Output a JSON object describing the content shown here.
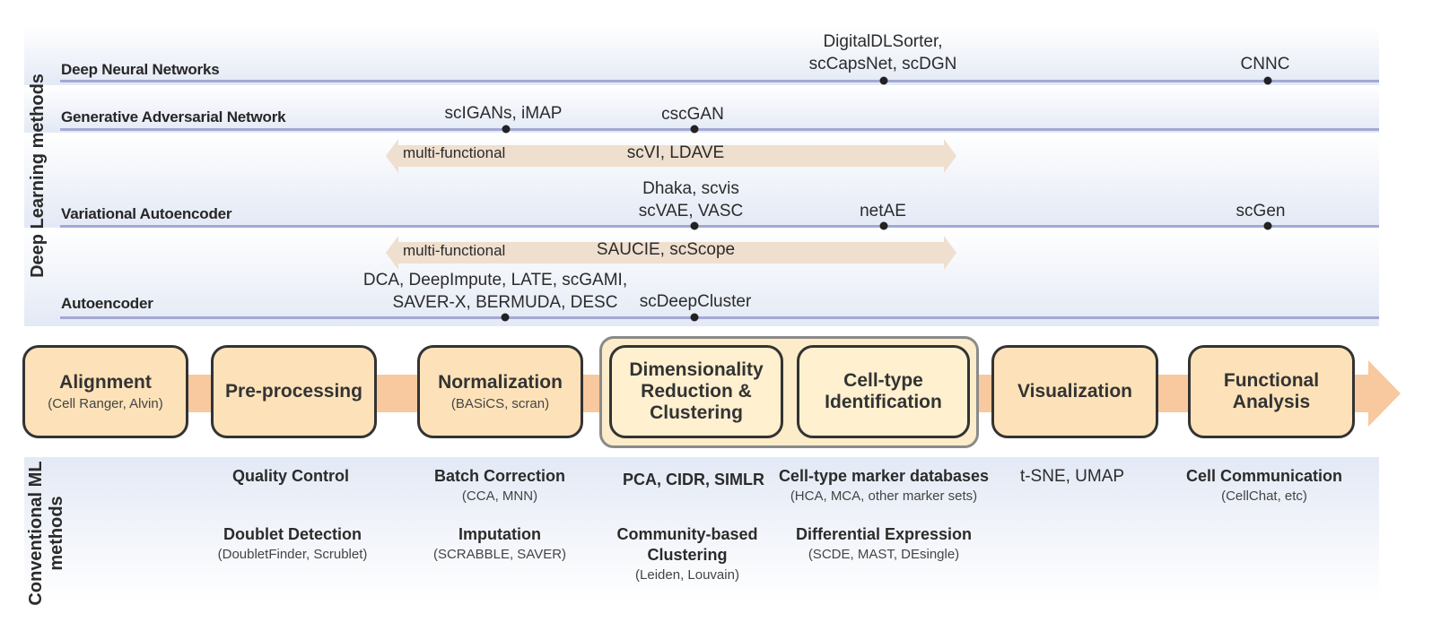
{
  "deep_learning": {
    "side_label": "Deep Learning methods",
    "categories": [
      {
        "name": "Deep Neural Networks"
      },
      {
        "name": "Generative Adversarial Network"
      },
      {
        "name": "Variational Autoencoder"
      },
      {
        "name": "Autoencoder"
      }
    ],
    "methods": {
      "dnn_1_line1": "DigitalDLSorter,",
      "dnn_1_line2": "scCapsNet, scDGN",
      "dnn_2": "CNNC",
      "gan_1": "scIGANs, iMAP",
      "gan_2": "cscGAN",
      "vae_1_line1": "Dhaka, scvis",
      "vae_1_line2": "scVAE, VASC",
      "vae_2": "netAE",
      "vae_3": "scGen",
      "ae_1_line1": "DCA, DeepImpute, LATE, scGAMI,",
      "ae_1_line2": "SAVER-X, BERMUDA, DESC",
      "ae_2": "scDeepCluster"
    },
    "multi_functional": [
      {
        "label": "multi-functional",
        "methods": "scVI, LDAVE"
      },
      {
        "label": "multi-functional",
        "methods": "SAUCIE, scScope"
      }
    ]
  },
  "pipeline": {
    "stages": [
      {
        "title": "Alignment",
        "sub": "(Cell Ranger, Alvin)"
      },
      {
        "title": "Pre-processing",
        "sub": ""
      },
      {
        "title": "Normalization",
        "sub": "(BASiCS, scran)"
      },
      {
        "title": "Dimensionality Reduction & Clustering",
        "title_l1": "Dimensionality",
        "title_l2": "Reduction &",
        "title_l3": "Clustering"
      },
      {
        "title": "Cell-type Identification",
        "title_l1": "Cell-type",
        "title_l2": "Identification"
      },
      {
        "title": "Visualization"
      },
      {
        "title": "Functional Analysis",
        "title_l1": "Functional",
        "title_l2": "Analysis"
      }
    ]
  },
  "conventional": {
    "side_label_l1": "Conventional ML",
    "side_label_l2": "methods",
    "items": [
      {
        "title": "Quality Control",
        "sub": ""
      },
      {
        "title": "Doublet Detection",
        "sub": "(DoubletFinder, Scrublet)"
      },
      {
        "title": "Batch Correction",
        "sub": "(CCA, MNN)"
      },
      {
        "title": "Imputation",
        "sub": "(SCRABBLE, SAVER)"
      },
      {
        "title": "PCA, CIDR, SIMLR",
        "sub": ""
      },
      {
        "title_l1": "Community-based",
        "title_l2": "Clustering",
        "sub": "(Leiden, Louvain)"
      },
      {
        "title": "Cell-type marker databases",
        "sub": "(HCA, MCA, other marker sets)"
      },
      {
        "title": "Differential Expression",
        "sub": "(SCDE, MAST, DEsingle)"
      },
      {
        "title": "t-SNE, UMAP",
        "sub": ""
      },
      {
        "title": "Cell Communication",
        "sub": "(CellChat, etc)"
      }
    ]
  },
  "colors": {
    "band_line": "#a3a9d3",
    "stage_fill": "#fde2b9",
    "pipeline_arrow": "#f8c89f",
    "multi_functional_arrow": "#efdfcf"
  }
}
